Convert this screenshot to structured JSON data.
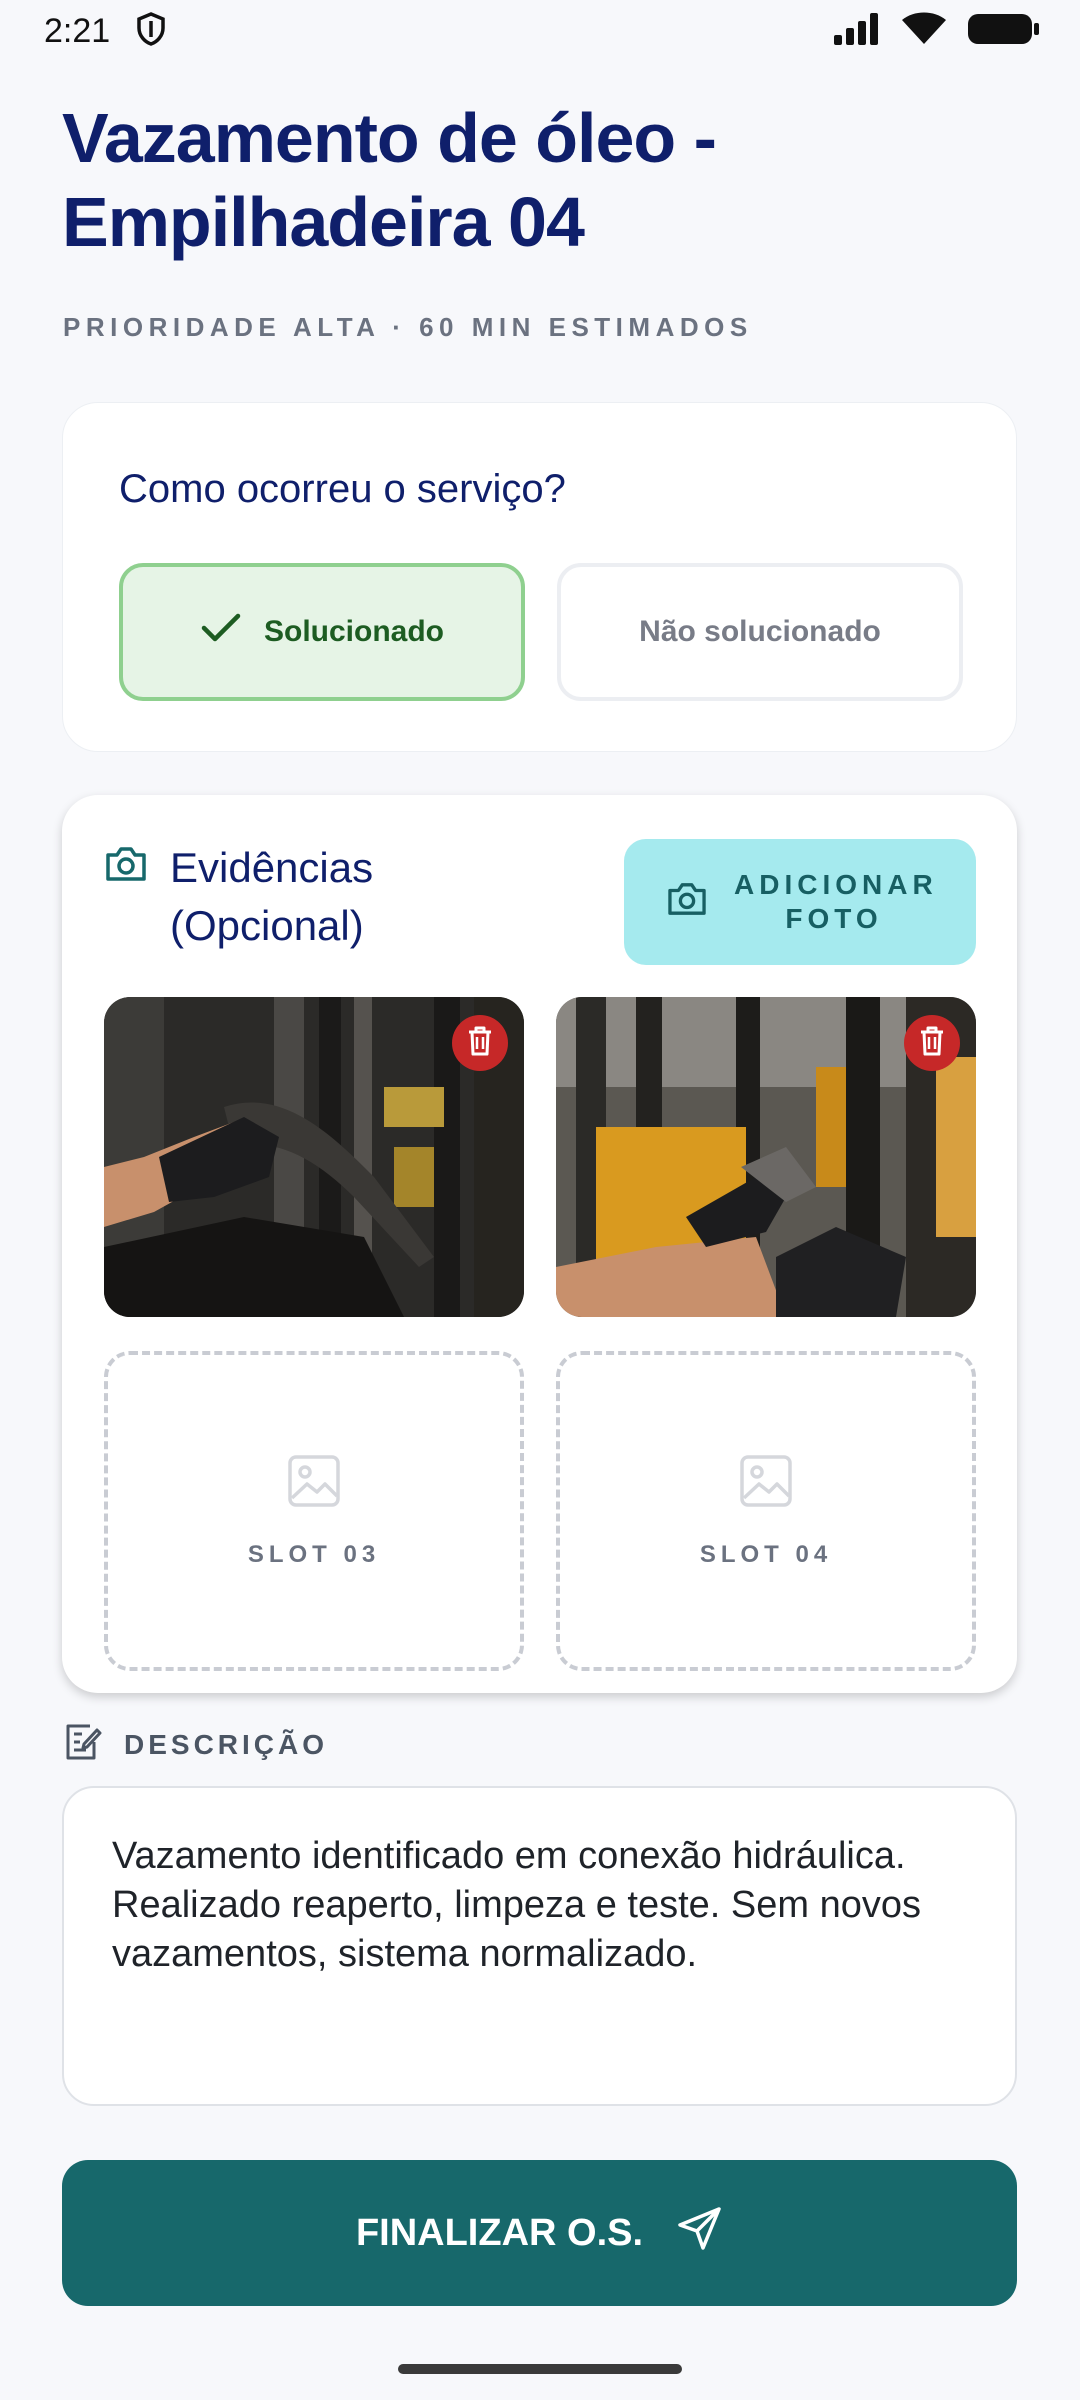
{
  "status_bar": {
    "time": "2:21"
  },
  "header": {
    "title": "Vazamento de óleo - Empilhadeira 04",
    "subtitle": "PRIORIDADE ALTA · 60 MIN ESTIMADOS"
  },
  "service_outcome": {
    "question": "Como ocorreu o serviço?",
    "options": [
      {
        "label": "Solucionado",
        "selected": true
      },
      {
        "label": "Não solucionado",
        "selected": false
      }
    ]
  },
  "evidence": {
    "title": "Evidências (Opcional)",
    "add_button": "ADICIONAR FOTO",
    "slots": [
      {
        "label": "SLOT 03"
      },
      {
        "label": "SLOT 04"
      }
    ]
  },
  "description": {
    "label": "DESCRIÇÃO",
    "text": "Vazamento identificado em conexão hidráulica. Realizado reaperto, limpeza e teste. Sem novos vazamentos, sistema normalizado."
  },
  "footer": {
    "finish_button": "FINALIZAR O.S."
  },
  "colors": {
    "brand": "#17686b",
    "title": "#0f1f6b",
    "success_bg": "#e6f4e6",
    "success_border": "#8fd08f",
    "add_button_bg": "#a5eaee",
    "delete": "#c62828"
  }
}
